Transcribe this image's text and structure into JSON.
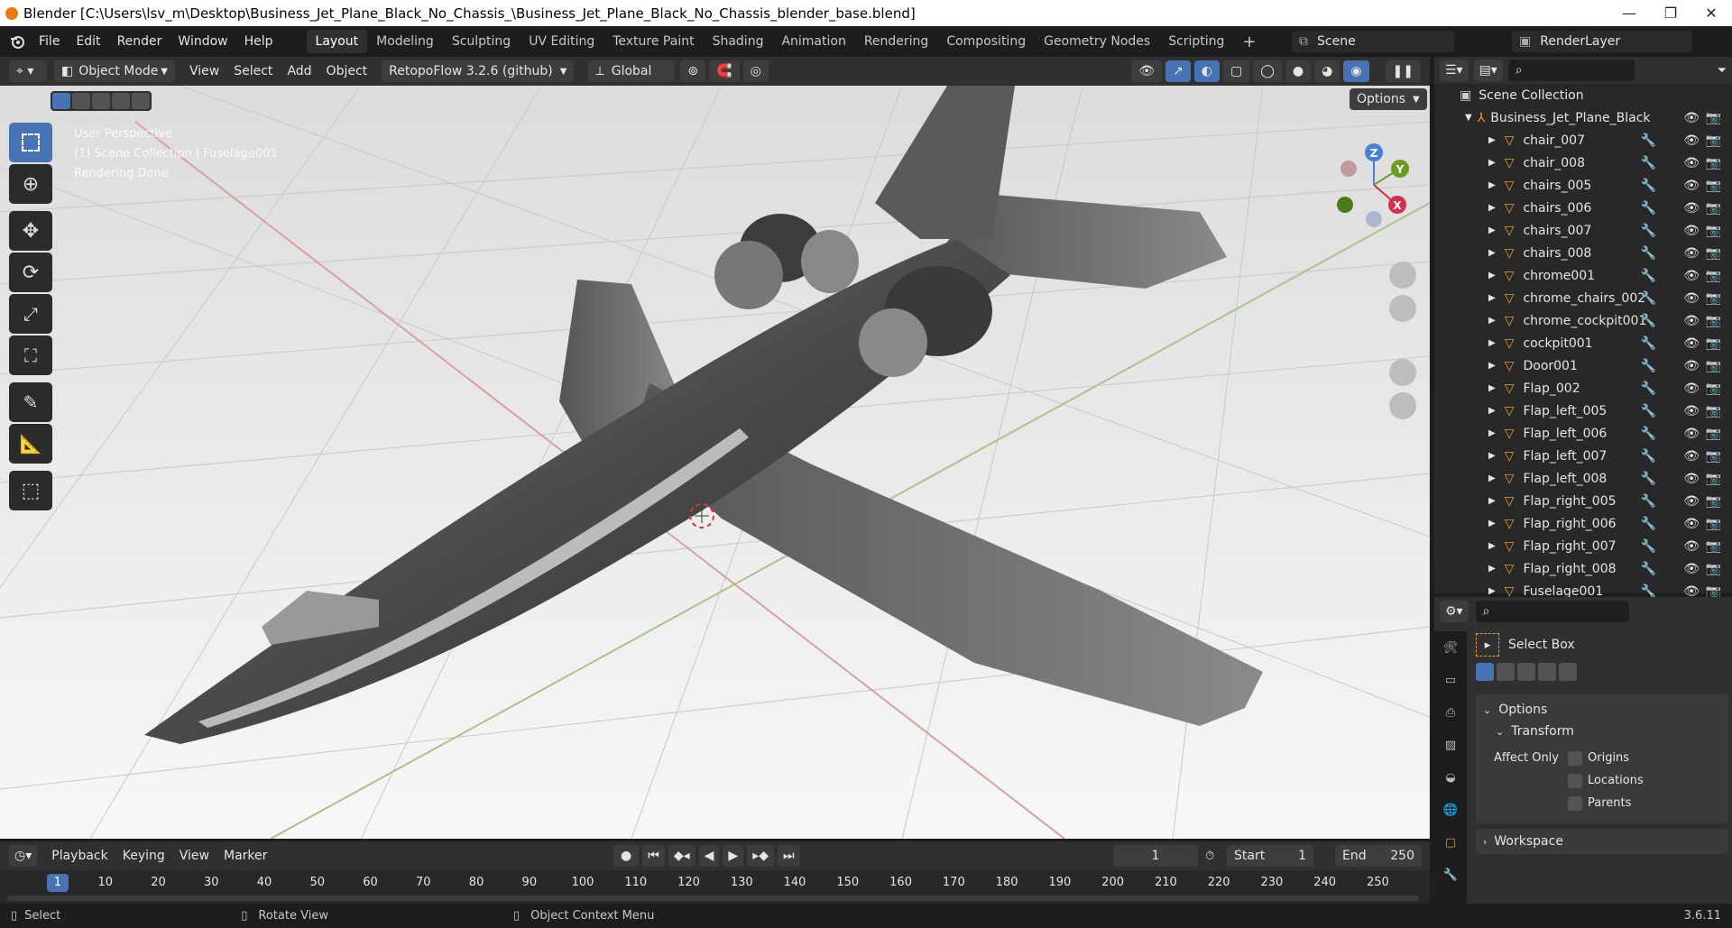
{
  "titlebar": {
    "title": "Blender [C:\\Users\\lsv_m\\Desktop\\Business_Jet_Plane_Black_No_Chassis_\\Business_Jet_Plane_Black_No_Chassis_blender_base.blend]",
    "minimize": "—",
    "maximize": "❐",
    "close": "✕"
  },
  "menu": [
    "File",
    "Edit",
    "Render",
    "Window",
    "Help"
  ],
  "workspaces": [
    "Layout",
    "Modeling",
    "Sculpting",
    "UV Editing",
    "Texture Paint",
    "Shading",
    "Animation",
    "Rendering",
    "Compositing",
    "Geometry Nodes",
    "Scripting"
  ],
  "add_workspace": "+",
  "scene": "Scene",
  "render_layer": "RenderLayer",
  "viewport_header": {
    "mode": "Object Mode",
    "menus": [
      "View",
      "Select",
      "Add",
      "Object"
    ],
    "retopoflow": "RetopoFlow 3.2.6 (github)",
    "orientation": "Global",
    "options": "Options"
  },
  "viewport_overlay": {
    "line1": "User Perspective",
    "line2": "(1) Scene Collection | Fuselage001",
    "line3": "Rendering Done"
  },
  "gizmo": {
    "x": "X",
    "y": "Y",
    "z": "Z"
  },
  "outliner": {
    "root": "Scene Collection",
    "collection": "Business_Jet_Plane_Black",
    "items": [
      "chair_007",
      "chair_008",
      "chairs_005",
      "chairs_006",
      "chairs_007",
      "chairs_008",
      "chrome001",
      "chrome_chairs_002",
      "chrome_cockpit001",
      "cockpit001",
      "Door001",
      "Flap_002",
      "Flap_left_005",
      "Flap_left_006",
      "Flap_left_007",
      "Flap_left_008",
      "Flap_right_005",
      "Flap_right_006",
      "Flap_right_007",
      "Flap_right_008",
      "Fuselage001"
    ]
  },
  "properties": {
    "tool_name": "Select Box",
    "options": "Options",
    "transform": "Transform",
    "affect_only": "Affect Only",
    "origins": "Origins",
    "locations": "Locations",
    "parents": "Parents",
    "workspace": "Workspace"
  },
  "timeline": {
    "menus": [
      "Playback",
      "Keying",
      "View",
      "Marker"
    ],
    "current_frame": "1",
    "start_label": "Start",
    "start": "1",
    "end_label": "End",
    "end": "250",
    "ticks": [
      "1",
      "10",
      "20",
      "30",
      "40",
      "50",
      "60",
      "70",
      "80",
      "90",
      "100",
      "110",
      "120",
      "130",
      "140",
      "150",
      "160",
      "170",
      "180",
      "190",
      "200",
      "210",
      "220",
      "230",
      "240",
      "250"
    ]
  },
  "status": {
    "select": "Select",
    "rotate": "Rotate View",
    "context": "Object Context Menu",
    "version": "3.6.11"
  }
}
